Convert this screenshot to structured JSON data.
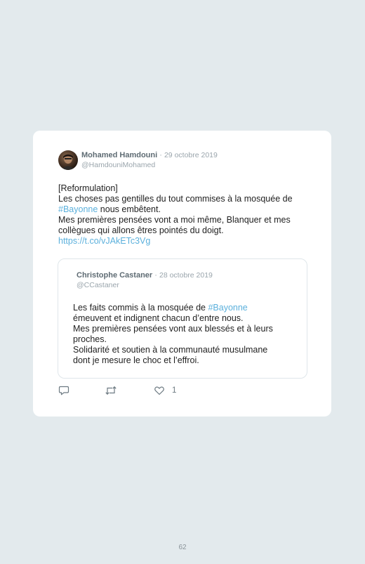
{
  "tweet": {
    "author_name": "Mohamed Hamdouni",
    "separator": "·",
    "date": "29 octobre 2019",
    "handle": "@HamdouniMohamed",
    "lines": [
      "[Reformulation]",
      "Les choses pas gentilles du tout commises à la mosquée de",
      "#Bayonne",
      " nous embêtent.",
      "Mes premières pensées vont a moi même, Blanquer et mes",
      "collègues qui allons êtres pointés du doigt.",
      "https://t.co/vJAkETc3Vg"
    ]
  },
  "quoted_tweet": {
    "author_name": "Christophe Castaner",
    "separator": "·",
    "date": "28 octobre 2019",
    "handle": "@CCastaner",
    "lines": [
      "Les faits commis à la mosquée de ",
      "#Bayonne",
      "émeuvent et indignent chacun d’entre nous.",
      "Mes premières pensées vont aux blessés et à leurs",
      "proches.",
      "Solidarité et soutien à la communauté musulmane",
      "dont je mesure le choc et l’effroi."
    ]
  },
  "actions": {
    "reply_icon": "reply-icon",
    "retweet_icon": "retweet-icon",
    "like_icon": "like-icon",
    "like_count": "1"
  },
  "page_number": "62",
  "colors": {
    "background": "#e3eaed",
    "link": "#5bb0dc",
    "muted": "#9aa5ac"
  }
}
